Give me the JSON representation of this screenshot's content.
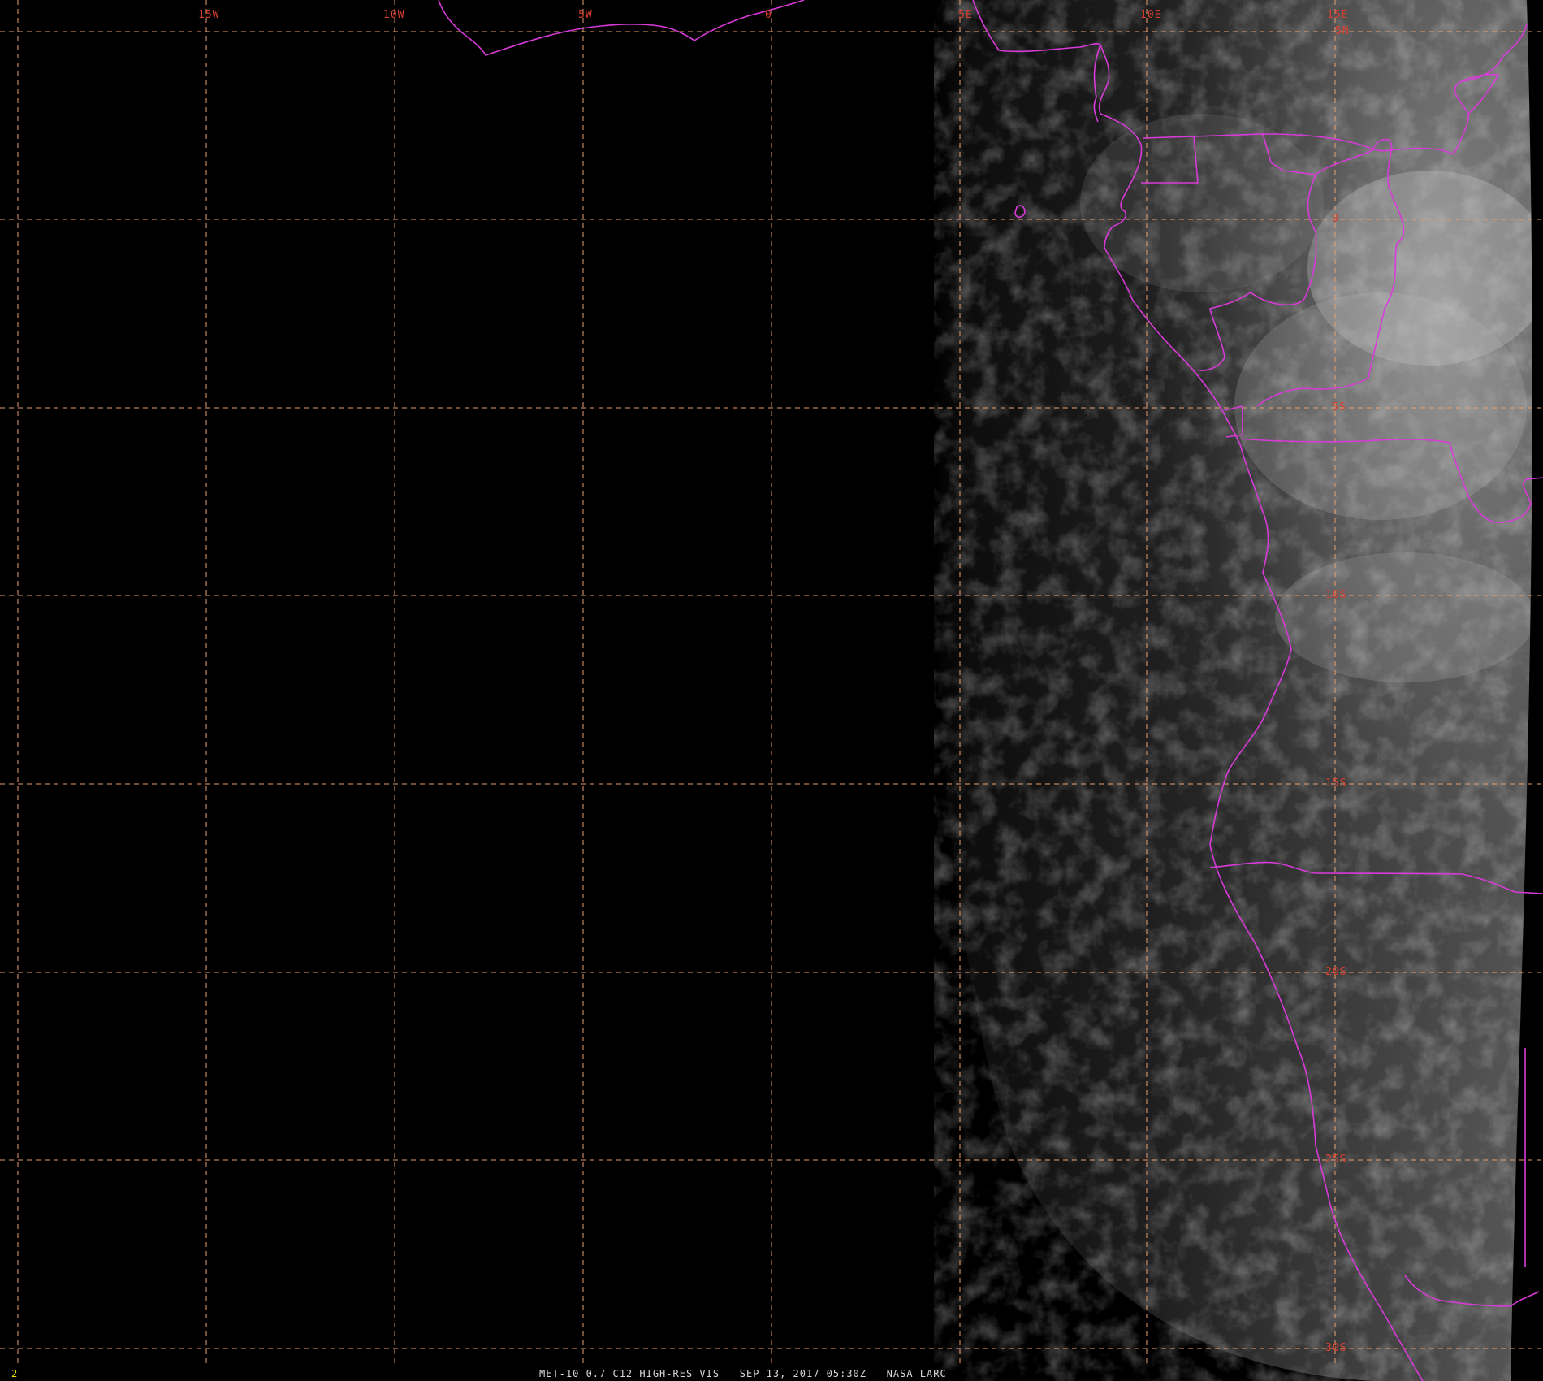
{
  "map": {
    "longitude_labels": [
      "15W",
      "10W",
      "5W",
      "0",
      "5E",
      "10E",
      "15E"
    ],
    "latitude_labels": [
      "5N",
      "0",
      "5S",
      "10S",
      "15S",
      "20S",
      "25S",
      "30S"
    ],
    "colors": {
      "background": "#000000",
      "grid": "#e8a070",
      "boundaries": "#d93ad9",
      "labels": "#d84030",
      "frame_number": "#e8e000"
    }
  },
  "footer": {
    "frame_number": "2",
    "caption": "MET-10 0.7 C12 HIGH-RES VIS   SEP 13, 2017 05:30Z   NASA LARC"
  }
}
